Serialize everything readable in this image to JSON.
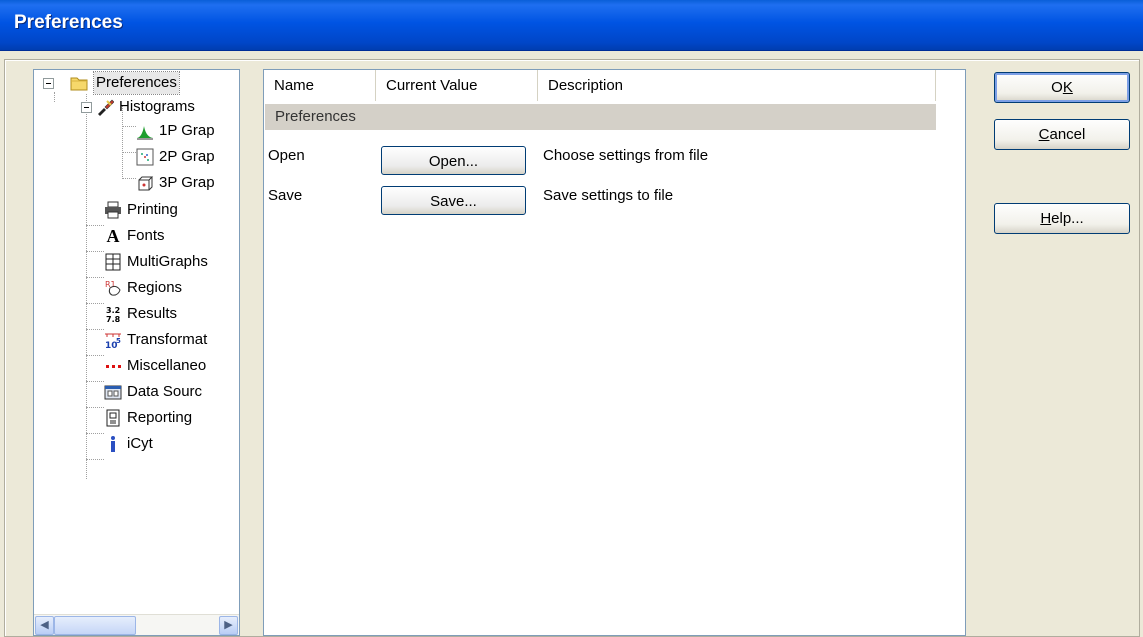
{
  "window": {
    "title": "Preferences"
  },
  "tree": {
    "root": "Preferences",
    "histograms": "Histograms",
    "graph1p": "1P Grap",
    "graph2p": "2P Grap",
    "graph3p": "3P Grap",
    "printing": "Printing",
    "fonts": "Fonts",
    "multigraphs": "MultiGraphs",
    "regions": "Regions",
    "results": "Results",
    "transformations": "Transformat",
    "miscellaneous": "Miscellaneo",
    "data_sources": "Data Sourc",
    "reporting": "Reporting",
    "icyt": "iCyt"
  },
  "grid": {
    "columns": {
      "name": "Name",
      "current_value": "Current Value",
      "description": "Description"
    },
    "section": "Preferences",
    "rows": [
      {
        "name": "Open",
        "button": "Open...",
        "description": "Choose settings from file"
      },
      {
        "name": "Save",
        "button": "Save...",
        "description": "Save settings to file"
      }
    ]
  },
  "buttons": {
    "ok": {
      "pre": "O",
      "u": "K",
      "post": ""
    },
    "cancel": {
      "pre": "",
      "u": "C",
      "post": "ancel"
    },
    "help": {
      "pre": "",
      "u": "H",
      "post": "elp..."
    }
  }
}
